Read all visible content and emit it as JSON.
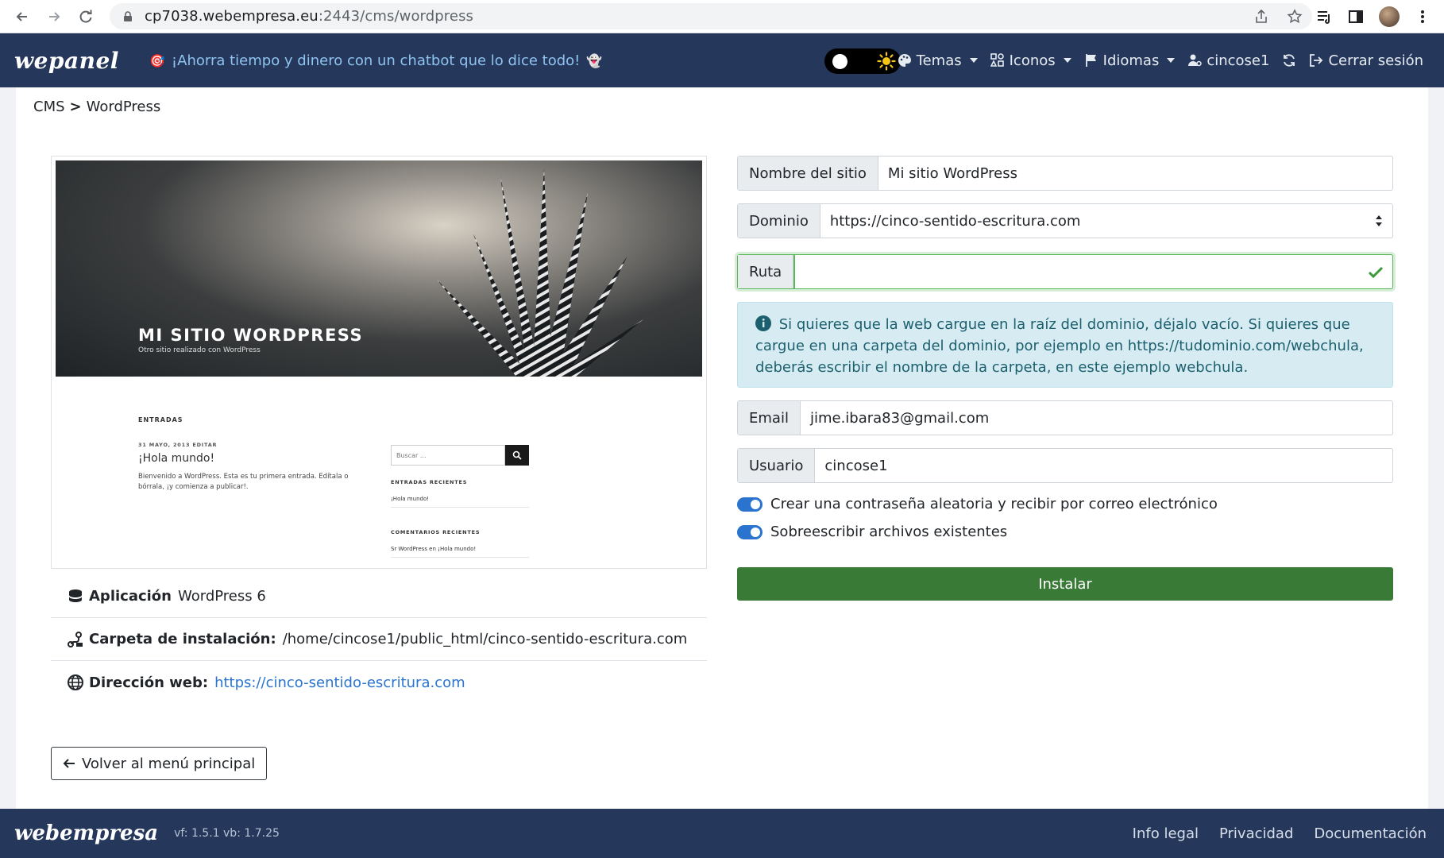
{
  "browser": {
    "url_host": "cp7038.webempresa.eu",
    "url_rest": ":2443/cms/wordpress"
  },
  "navbar": {
    "brand": "wepanel",
    "promo": "¡Ahorra tiempo y dinero con un chatbot que lo dice todo!",
    "items": {
      "temas": "Temas",
      "iconos": "Iconos",
      "idiomas": "Idiomas",
      "user": "cincose1",
      "logout": "Cerrar sesión"
    }
  },
  "breadcrumb": {
    "root": "CMS",
    "separator": ">",
    "current": "WordPress"
  },
  "preview": {
    "site_title": "MI SITIO WORDPRESS",
    "site_tagline": "Otro sitio realizado con WordPress",
    "entradas": "ENTRADAS",
    "post_meta": "31 MAYO, 2013   EDITAR",
    "post_title": "¡Hola mundo!",
    "post_text": "Bienvenido a WordPress. Esta es tu primera entrada. Edítala o bórrala, ¡y comienza a publicar!.",
    "search_placeholder": "Buscar ...",
    "recent_posts_heading": "ENTRADAS RECIENTES",
    "recent_post": "¡Hola mundo!",
    "recent_comments_heading": "COMENTARIOS RECIENTES",
    "recent_comment": "Sr WordPress en ¡Hola mundo!"
  },
  "info": {
    "app_label": "Aplicación",
    "app_value": "WordPress 6",
    "folder_label": "Carpeta de instalación:",
    "folder_value": "/home/cincose1/public_html/cinco-sentido-escritura.com",
    "web_label": "Dirección web:",
    "web_value": "https://cinco-sentido-escritura.com"
  },
  "back_button": "Volver al menú principal",
  "form": {
    "site_name_label": "Nombre del sitio",
    "site_name_value": "Mi sitio WordPress",
    "domain_label": "Dominio",
    "domain_value": "https://cinco-sentido-escritura.com",
    "path_label": "Ruta",
    "path_value": "",
    "help_text": "Si quieres que la web cargue en la raíz del dominio, déjalo vacío. Si quieres que cargue en una carpeta del dominio, por ejemplo en https://tudominio.com/webchula, deberás escribir el nombre de la carpeta, en este ejemplo webchula.",
    "email_label": "Email",
    "email_value": "jime.ibara83@gmail.com",
    "user_label": "Usuario",
    "user_value": "cincose1",
    "switch_password": "Crear una contraseña aleatoria y recibir por correo electrónico",
    "switch_overwrite": "Sobreescribir archivos existentes",
    "install_button": "Instalar"
  },
  "footer": {
    "logo": "webempresa",
    "version": "vf: 1.5.1 vb: 1.7.25",
    "links": {
      "legal": "Info legal",
      "privacy": "Privacidad",
      "docs": "Documentación"
    }
  },
  "colors": {
    "navbar_bg": "#25375a",
    "install_green": "#3a7a37",
    "link_blue": "#2a74cf",
    "alert_bg": "#d6ecf2"
  }
}
